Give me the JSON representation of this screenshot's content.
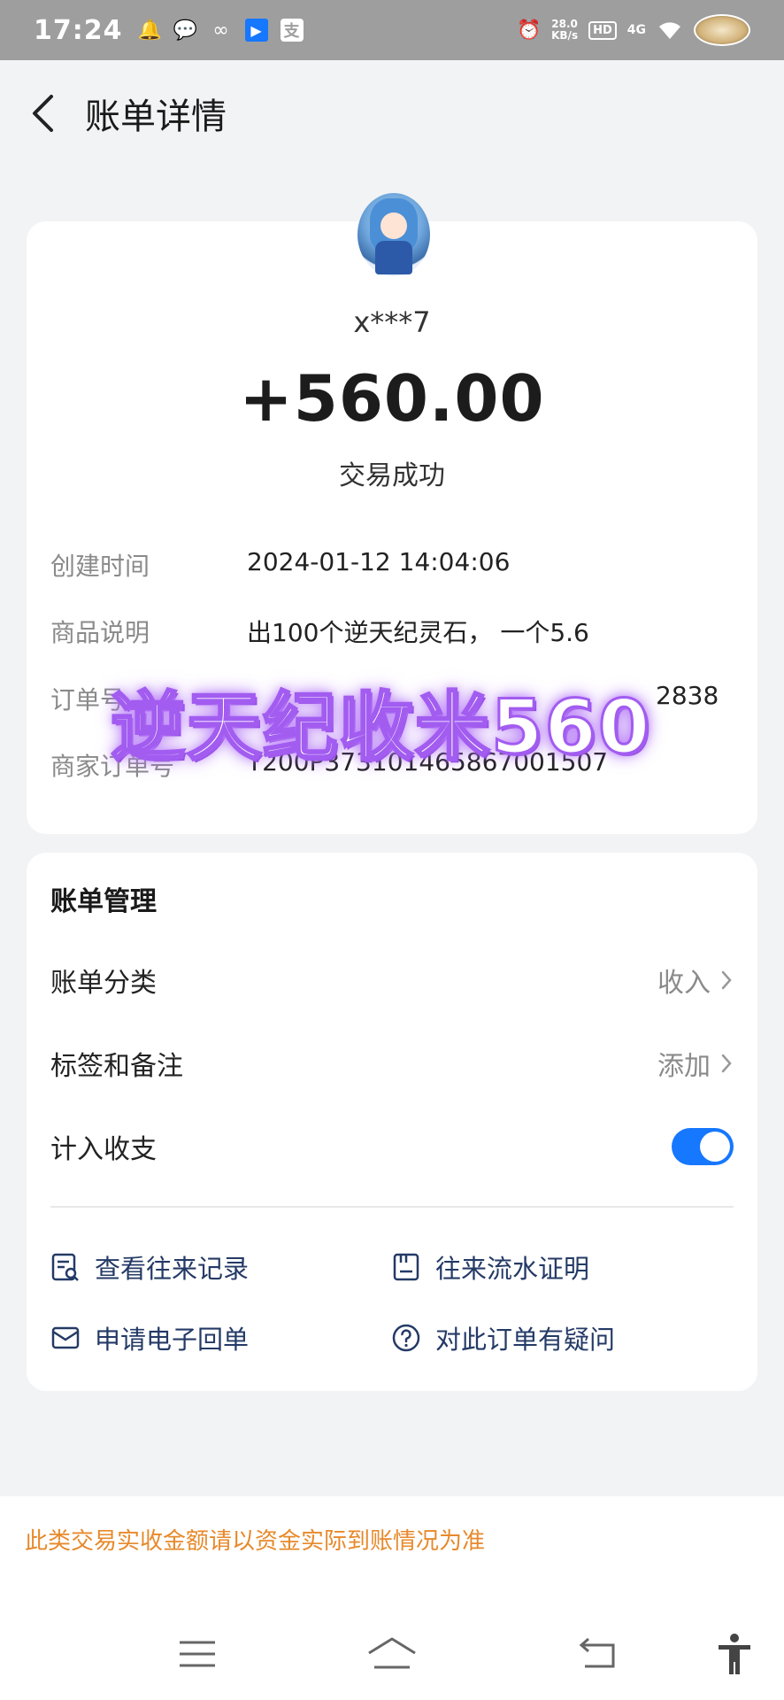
{
  "status_bar": {
    "time": "17:24",
    "speed_value": "28.0",
    "speed_unit": "KB/s",
    "hd": "HD",
    "network": "4G",
    "left_icons": [
      "bell-icon",
      "wechat-icon",
      "link-icon",
      "app-icon",
      "alipay-icon"
    ],
    "alipay_glyph": "支"
  },
  "header": {
    "title": "账单详情"
  },
  "transaction": {
    "payer": "x***7",
    "amount": "+560.00",
    "status": "交易成功",
    "details": [
      {
        "label": "创建时间",
        "value": "2024-01-12 14:04:06"
      },
      {
        "label": "商品说明",
        "value": "出100个逆天纪灵石， 一个5.6"
      },
      {
        "label": "订单号",
        "value": "2838"
      },
      {
        "label": "商家订单号",
        "value": "T200P373101465867001507"
      }
    ]
  },
  "overlay": {
    "text": "逆天纪收米560"
  },
  "management": {
    "title": "账单管理",
    "category_label": "账单分类",
    "category_value": "收入",
    "tag_label": "标签和备注",
    "tag_value": "添加",
    "include_label": "计入收支",
    "include_enabled": true,
    "actions": [
      {
        "label": "查看往来记录",
        "icon": "record-search-icon"
      },
      {
        "label": "往来流水证明",
        "icon": "statement-icon"
      },
      {
        "label": "申请电子回单",
        "icon": "mail-icon"
      },
      {
        "label": "对此订单有疑问",
        "icon": "question-icon"
      }
    ]
  },
  "notice": "此类交易实收金额请以资金实际到账情况为准",
  "colors": {
    "accent": "#1677ff",
    "notice": "#e7892b",
    "overlay_stroke": "#a25cf0"
  }
}
